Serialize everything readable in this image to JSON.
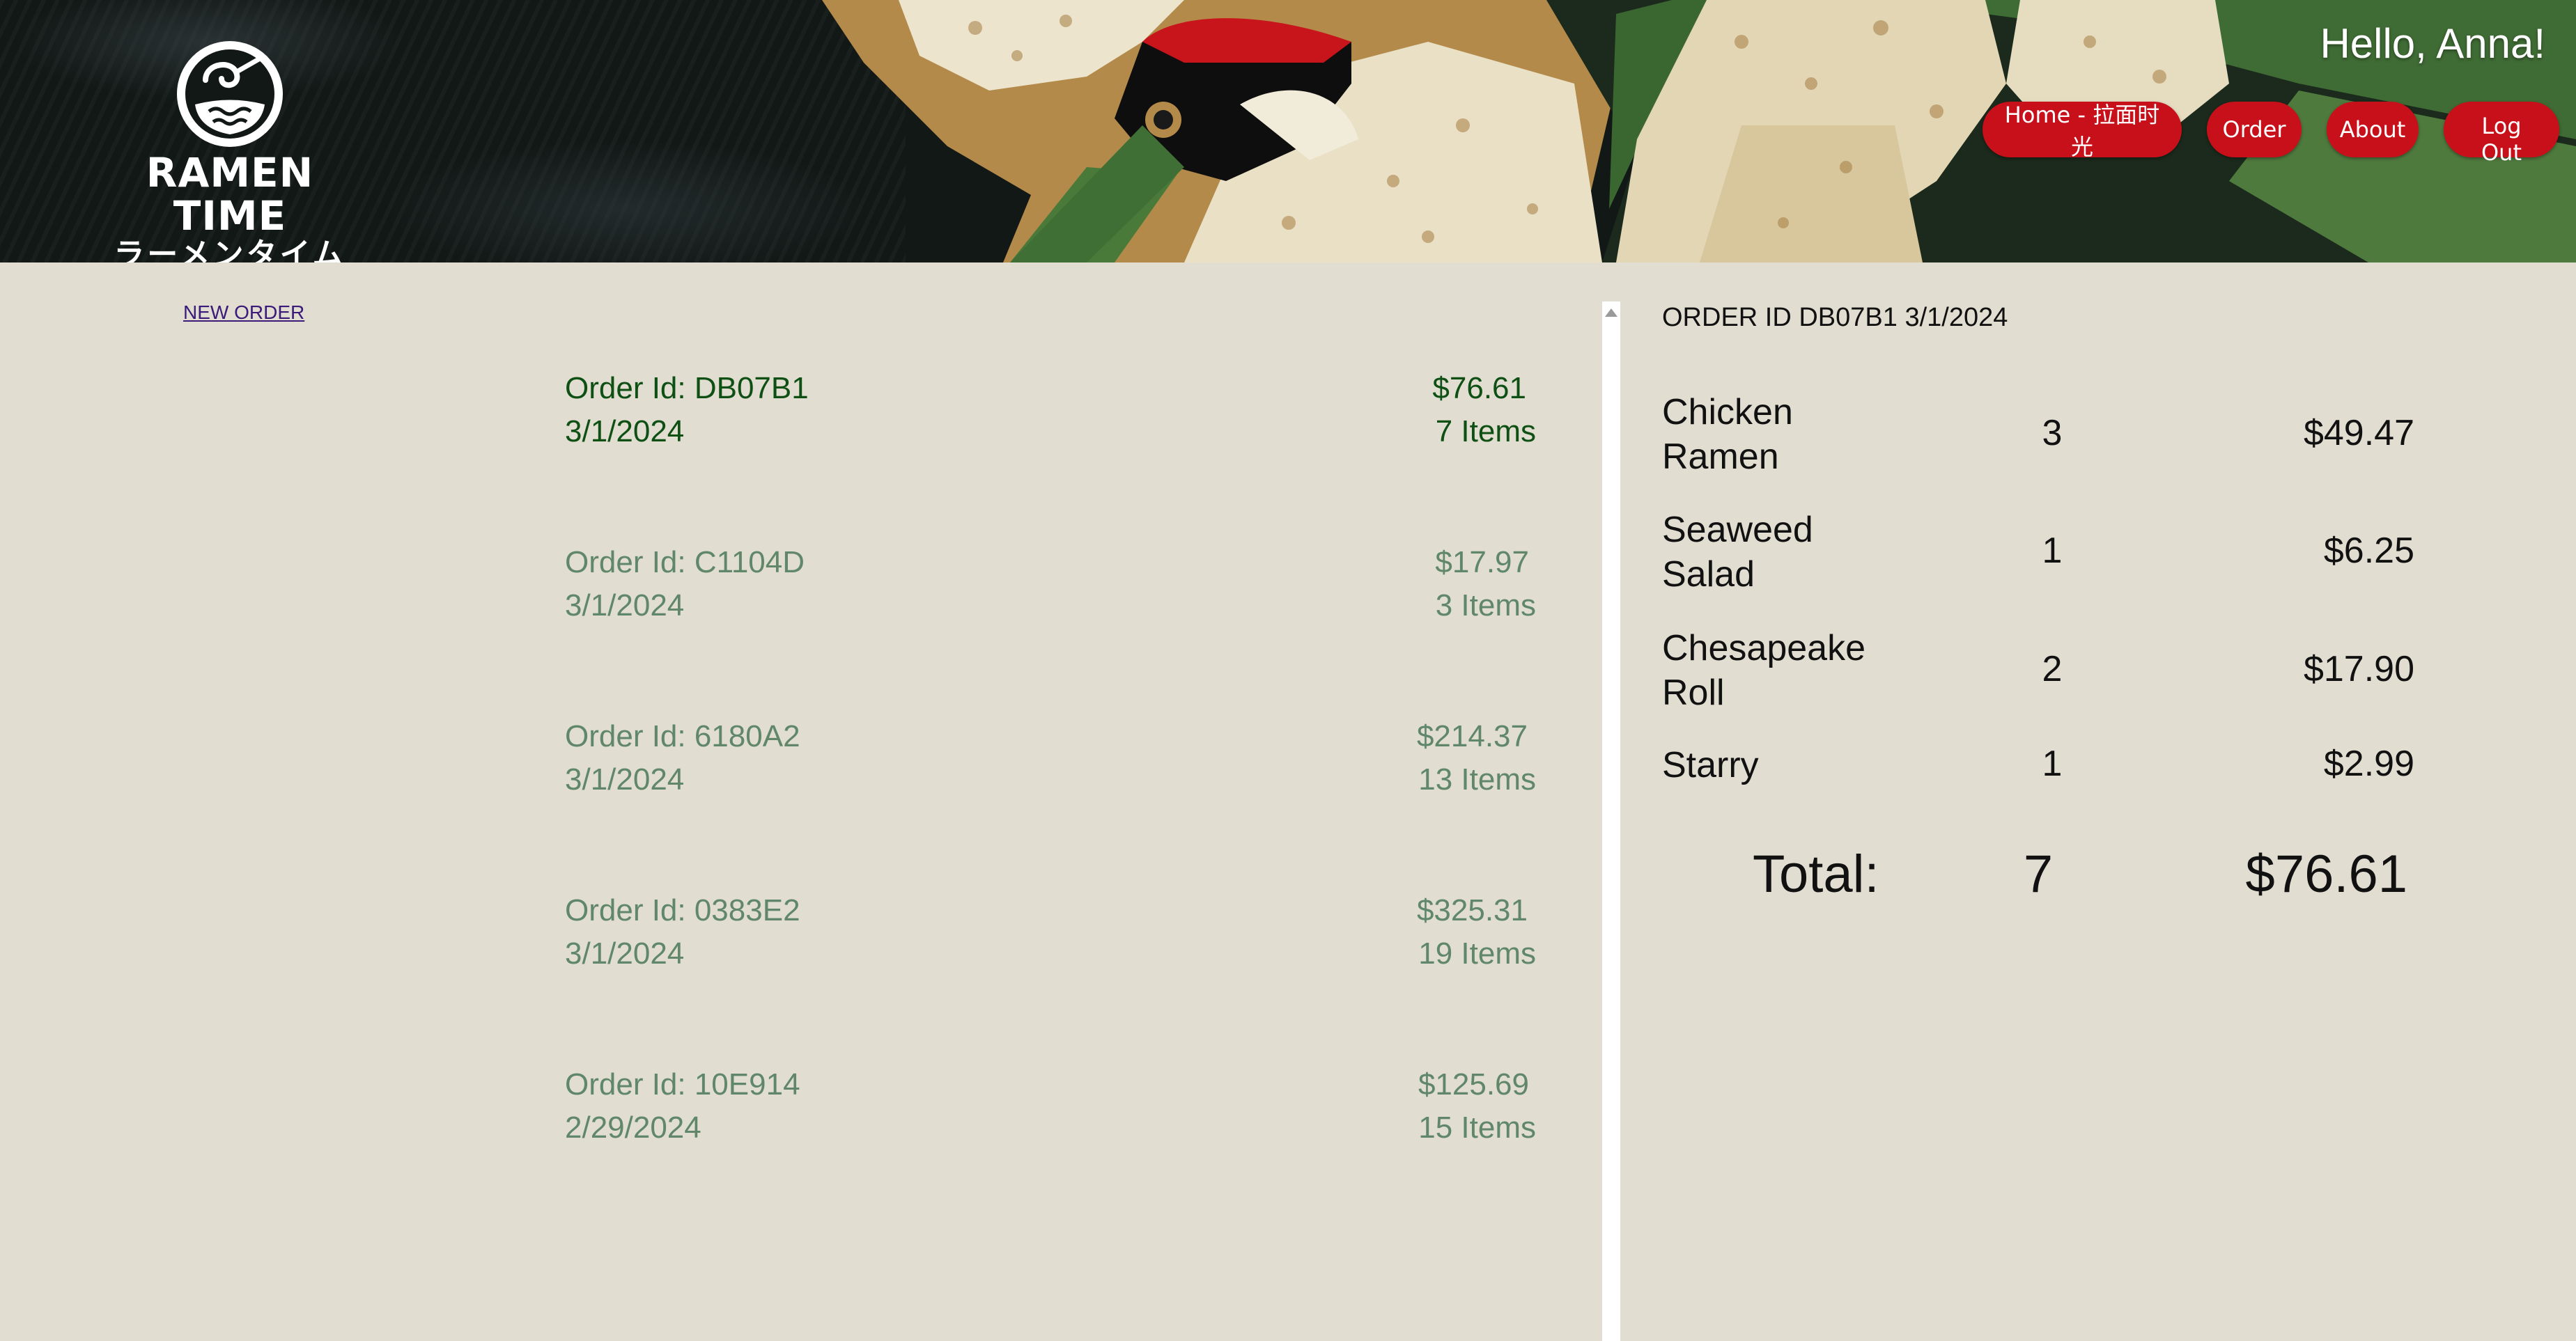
{
  "brand": {
    "name": "RAMEN TIME",
    "subtitle": "ラーメンタイム"
  },
  "header": {
    "greeting": "Hello, Anna!",
    "nav": [
      {
        "label": "Home - 拉面时光"
      },
      {
        "label": "Order"
      },
      {
        "label": "About"
      },
      {
        "label": "Log Out"
      }
    ]
  },
  "orders_pane": {
    "new_order_label": "NEW ORDER",
    "orders": [
      {
        "id_label": "Order Id: DB07B1",
        "date": "3/1/2024",
        "total": "$76.61",
        "items": "7 Items",
        "selected": true
      },
      {
        "id_label": "Order Id: C1104D",
        "date": "3/1/2024",
        "total": "$17.97",
        "items": "3 Items",
        "selected": false
      },
      {
        "id_label": "Order Id: 6180A2",
        "date": "3/1/2024",
        "total": "$214.37",
        "items": "13 Items",
        "selected": false
      },
      {
        "id_label": "Order Id: 0383E2",
        "date": "3/1/2024",
        "total": "$325.31",
        "items": "19 Items",
        "selected": false
      },
      {
        "id_label": "Order Id: 10E914",
        "date": "2/29/2024",
        "total": "$125.69",
        "items": "15 Items",
        "selected": false
      }
    ]
  },
  "order_detail": {
    "header": "ORDER ID DB07B1 3/1/2024",
    "items": [
      {
        "name": "Chicken Ramen",
        "qty": "3",
        "price": "$49.47"
      },
      {
        "name": "Seaweed Salad",
        "qty": "1",
        "price": "$6.25"
      },
      {
        "name": "Chesapeake Roll",
        "qty": "2",
        "price": "$17.90"
      },
      {
        "name": "Starry",
        "qty": "1",
        "price": "$2.99"
      }
    ],
    "total_label": "Total:",
    "total_qty": "7",
    "total_price": "$76.61"
  },
  "colors": {
    "background": "#e1ddd1",
    "nav_button": "#c8101b",
    "order_selected": "#0e5014",
    "order_default": "#60876a",
    "link": "#3b1a7a"
  }
}
